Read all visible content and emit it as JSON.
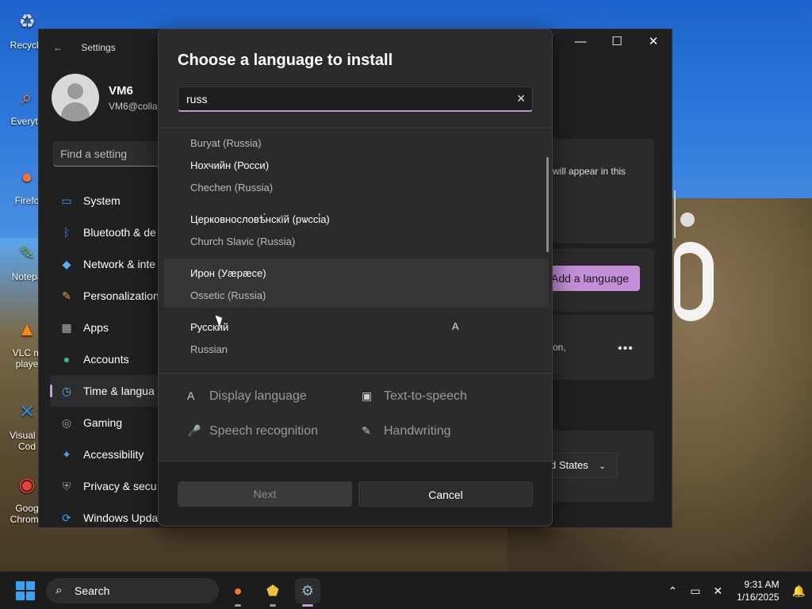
{
  "desktop": {
    "icons": [
      {
        "label": "Recycle",
        "glyph": "♻",
        "color": "#cfd8e3"
      },
      {
        "label": "Everyth",
        "glyph": "⌕",
        "color": "#f08a24"
      },
      {
        "label": "Firefo",
        "glyph": "●",
        "color": "#ff7139"
      },
      {
        "label": "Notepa",
        "glyph": "✎",
        "color": "#7ec27a"
      },
      {
        "label": "VLC m\nplaye",
        "glyph": "▲",
        "color": "#ff8800"
      },
      {
        "label": "Visual S\nCod",
        "glyph": "✕",
        "color": "#2f8ad8"
      },
      {
        "label": "Goog\nChrome",
        "glyph": "◉",
        "color": "#e94235"
      }
    ]
  },
  "settings": {
    "title": "Settings",
    "profile": {
      "name": "VM6",
      "email": "VM6@collal"
    },
    "search_placeholder": "Find a setting",
    "nav": [
      {
        "label": "System",
        "icon": "system-icon",
        "color": "#3aa0f3",
        "glyph": "▭"
      },
      {
        "label": "Bluetooth & de",
        "icon": "bluetooth-icon",
        "color": "#3a7de0",
        "glyph": "ᛒ"
      },
      {
        "label": "Network & inte",
        "icon": "network-icon",
        "color": "#58b0f5",
        "glyph": "◆"
      },
      {
        "label": "Personalization",
        "icon": "brush-icon",
        "color": "#e0a050",
        "glyph": "✎"
      },
      {
        "label": "Apps",
        "icon": "apps-icon",
        "color": "#b0b0b0",
        "glyph": "▦"
      },
      {
        "label": "Accounts",
        "icon": "accounts-icon",
        "color": "#3cc080",
        "glyph": "●"
      },
      {
        "label": "Time & langua",
        "icon": "time-language-icon",
        "color": "#5ab0f0",
        "glyph": "◷"
      },
      {
        "label": "Gaming",
        "icon": "gaming-icon",
        "color": "#a0a0a0",
        "glyph": "◎"
      },
      {
        "label": "Accessibility",
        "icon": "accessibility-icon",
        "color": "#4aa8f0",
        "glyph": "✦"
      },
      {
        "label": "Privacy & secu",
        "icon": "shield-icon",
        "color": "#909090",
        "glyph": "⛨"
      },
      {
        "label": "Windows Upda",
        "icon": "update-icon",
        "color": "#3aa0f3",
        "glyph": "⟳"
      }
    ],
    "active_nav_index": 6,
    "right": {
      "card1_text": "will appear in this",
      "add_language_label": "Add a language",
      "card2_text": "on,",
      "more_label": "•••",
      "region_value": "d States"
    }
  },
  "dialog": {
    "title": "Choose a language to install",
    "search_value": "russ",
    "clear_glyph": "✕",
    "languages": [
      {
        "native": "",
        "english": "Buryat (Russia)"
      },
      {
        "native": "Нохчийн (Росси)",
        "english": "Chechen (Russia)"
      },
      {
        "native": "Церковнословѣ́нскїй (рѡссі́а)",
        "english": "Church Slavic (Russia)"
      },
      {
        "native": "Ирон (Уæрæсе)",
        "english": "Ossetic (Russia)"
      },
      {
        "native": "Русский",
        "english": "Russian"
      }
    ],
    "hovered_index": 3,
    "features": [
      {
        "label": "Display language",
        "icon": "display-language-icon",
        "glyph": "A"
      },
      {
        "label": "Text-to-speech",
        "icon": "text-to-speech-icon",
        "glyph": "▣"
      },
      {
        "label": "Speech recognition",
        "icon": "microphone-icon",
        "glyph": "🎤"
      },
      {
        "label": "Handwriting",
        "icon": "handwriting-icon",
        "glyph": "✎"
      }
    ],
    "next_label": "Next",
    "cancel_label": "Cancel"
  },
  "taskbar": {
    "search_label": "Search",
    "time": "9:31 AM",
    "date": "1/16/2025"
  }
}
